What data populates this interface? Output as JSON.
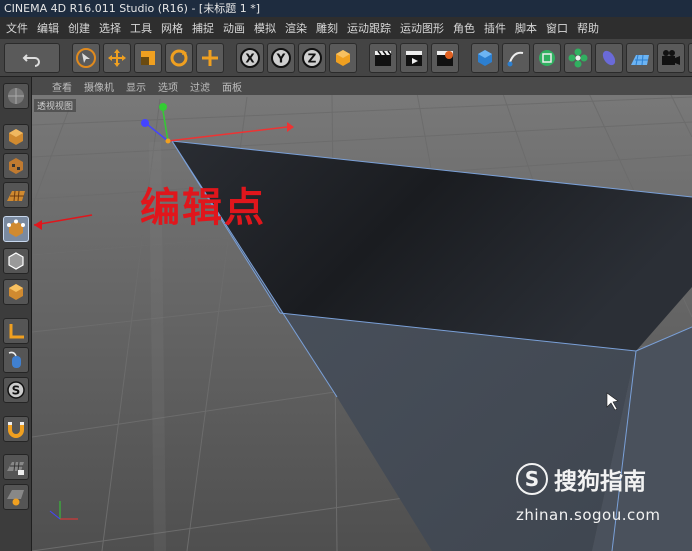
{
  "window": {
    "title": "CINEMA 4D R16.011 Studio (R16) - [未标题 1 *]"
  },
  "menu": {
    "items": [
      "文件",
      "编辑",
      "创建",
      "选择",
      "工具",
      "网格",
      "捕捉",
      "动画",
      "模拟",
      "渲染",
      "雕刻",
      "运动跟踪",
      "运动图形",
      "角色",
      "插件",
      "脚本",
      "窗口",
      "帮助"
    ]
  },
  "toolbar": {
    "undo_icon": "undo-icon",
    "axis_x_label": "X",
    "axis_y_label": "Y",
    "axis_z_label": "Z"
  },
  "viewport": {
    "menu": [
      "查看",
      "摄像机",
      "显示",
      "选项",
      "过滤",
      "面板"
    ],
    "label": "透视视图"
  },
  "annotation": {
    "text": "编辑点"
  },
  "watermark": {
    "logo": "S",
    "text": "搜狗指南",
    "url": "zhinan.sogou.com"
  },
  "colors": {
    "accent": "#e0161c",
    "toolbar": "#444444",
    "titlebar": "#1e2c3f"
  }
}
